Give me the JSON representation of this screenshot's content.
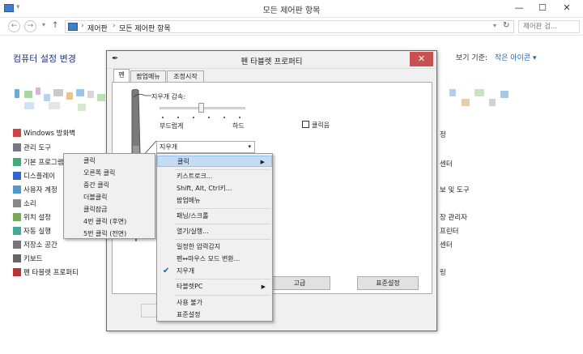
{
  "window": {
    "title": "모든 제어판 항목",
    "minimize": "—",
    "maximize": "☐",
    "close": "✕"
  },
  "address": {
    "back": "←",
    "forward": "→",
    "up": "↑",
    "crumbs": [
      "제어판",
      "모든 제어판 항목"
    ],
    "sep": "›",
    "refresh": "↻",
    "search_placeholder": "제어판 검..."
  },
  "page": {
    "heading": "컴퓨터 설정 변경",
    "viewby_label": "보기 기준:",
    "viewby_value": "작은 아이콘 ▾"
  },
  "left_items": [
    {
      "label": "Windows 방화벽",
      "color": "#c44"
    },
    {
      "label": "관리 도구",
      "color": "#778"
    },
    {
      "label": "기본 프로그램",
      "color": "#4a7"
    },
    {
      "label": "디스플레이",
      "color": "#36c"
    },
    {
      "label": "사용자 계정",
      "color": "#59c"
    },
    {
      "label": "소리",
      "color": "#888"
    },
    {
      "label": "위치 설정",
      "color": "#7a5"
    },
    {
      "label": "자동 실행",
      "color": "#4a9"
    },
    {
      "label": "저장소 공간",
      "color": "#777"
    },
    {
      "label": "키보드",
      "color": "#666"
    },
    {
      "label": "펜 타블렛 프로퍼티",
      "color": "#b33"
    }
  ],
  "right_items": [
    "정",
    "센터",
    "보 및 도구",
    "장 관리자",
    "프린터",
    "센터",
    "링"
  ],
  "dialog": {
    "title": "펜 타블렛 프로퍼티",
    "close": "✕",
    "tabs": [
      "펜",
      "팝업메뉴",
      "조정시작"
    ],
    "eraser_sensitivity": "지우개 감속:",
    "soft": "부드럽게",
    "hard": "하드",
    "click_sound_label": "클릭음",
    "combo_value": "지우개",
    "advanced_button": "고급",
    "default_button": "표준설정"
  },
  "submenu_left": [
    "클릭",
    "오른쪽 클릭",
    "중간 클릭",
    "더블클릭",
    "클릭잠금",
    "4번 클릭 (후면)",
    "5번 클릭 (전면)"
  ],
  "context_menu": {
    "items": [
      "클릭",
      "키스트로크...",
      "Shift, Alt, Ctrl키...",
      "팝업메뉴",
      "패닝/스크롤",
      "열기/실행...",
      "일정한 압력감지",
      "펜↔마우스 모드 변환...",
      "지우개",
      "타블렛PC",
      "사용 불가",
      "표준설정"
    ],
    "arrow": "▶",
    "check": "✔"
  }
}
